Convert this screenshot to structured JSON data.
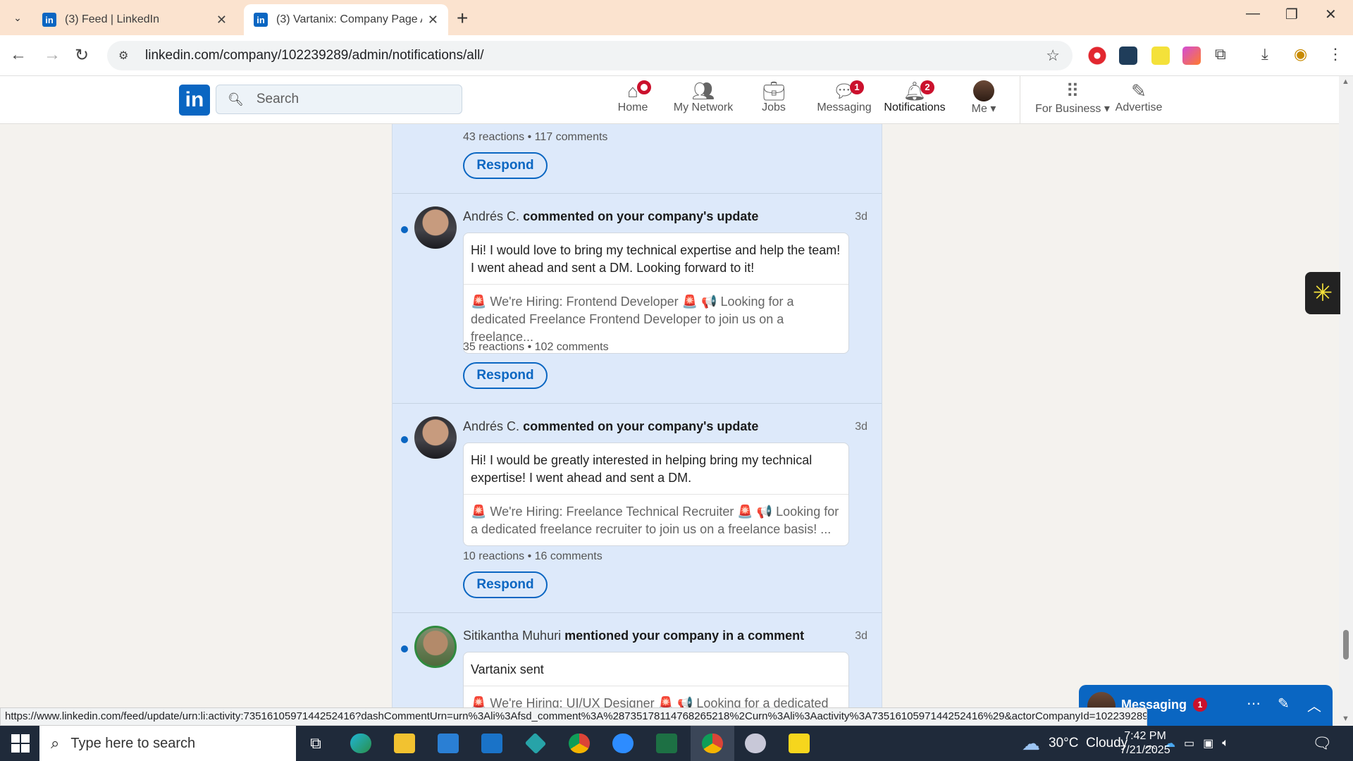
{
  "browser": {
    "tabs": [
      {
        "title": "(3) Feed | LinkedIn",
        "active": false
      },
      {
        "title": "(3) Vartanix: Company Page Admin",
        "active": true
      }
    ],
    "url": "linkedin.com/company/102239289/admin/notifications/all/",
    "status_url": "https://www.linkedin.com/feed/update/urn:li:activity:7351610597144252416?dashCommentUrn=urn%3Ali%3Afsd_comment%3A%287351781147682652​18%2Curn%3Ali%3Aactivity%3A7351610597144252416%29&actorCompanyId=102239289"
  },
  "linkedin": {
    "logo": "in",
    "search_placeholder": "Search",
    "nav": [
      {
        "label": "Home",
        "icon": "home-icon",
        "badge": "dot"
      },
      {
        "label": "My Network",
        "icon": "people-icon",
        "badge": ""
      },
      {
        "label": "Jobs",
        "icon": "briefcase-icon",
        "badge": ""
      },
      {
        "label": "Messaging",
        "icon": "chat-icon",
        "badge": "1"
      },
      {
        "label": "Notifications",
        "icon": "bell-icon",
        "badge": "2"
      },
      {
        "label": "Me",
        "icon": "avatar",
        "badge": ""
      },
      {
        "label": "For Business",
        "icon": "grid-icon",
        "badge": ""
      },
      {
        "label": "Advertise",
        "icon": "advertise-icon",
        "badge": ""
      }
    ]
  },
  "top_stats": "43 reactions  •  117 comments",
  "respond_label": "Respond",
  "notifications": [
    {
      "actor": "Andrés C.",
      "action": "commented on your company's update",
      "time": "3d",
      "comment": "Hi! I would love to bring my technical expertise and help the team! I went ahead and sent a DM. Looking forward to it!",
      "snippet": "🚨 We're Hiring: Frontend Developer 🚨   📢 Looking for a dedicated Freelance Frontend Developer to join us on a freelance...",
      "stats": "35 reactions  •  102 comments"
    },
    {
      "actor": "Andrés C.",
      "action": "commented on your company's update",
      "time": "3d",
      "comment": "Hi! I would be greatly interested in helping bring my technical expertise! I went ahead and sent a DM.",
      "snippet": "🚨 We're Hiring: Freelance Technical Recruiter 🚨   📢 Looking for a dedicated freelance recruiter to join us on a freelance basis!    ...",
      "stats": "10 reactions  •  16 comments"
    },
    {
      "actor": "Sitikantha Muhuri",
      "action": "mentioned your company in a comment",
      "time": "3d",
      "comment": "Vartanix sent",
      "snippet": "🚨 We're Hiring: UI/UX Designer 🚨   📢 Looking for a dedicated",
      "stats": ""
    }
  ],
  "messaging": {
    "title": "Messaging",
    "badge": "1"
  },
  "taskbar": {
    "search_placeholder": "Type here to search",
    "weather": "30°C  Cloudy",
    "weather_badge": "1",
    "time": "7:42 PM",
    "date": "7/21/2025"
  },
  "colors": {
    "linkedin_blue": "#0a66c2",
    "badge_red": "#cb112d",
    "unread_bg": "#dde9fa"
  }
}
